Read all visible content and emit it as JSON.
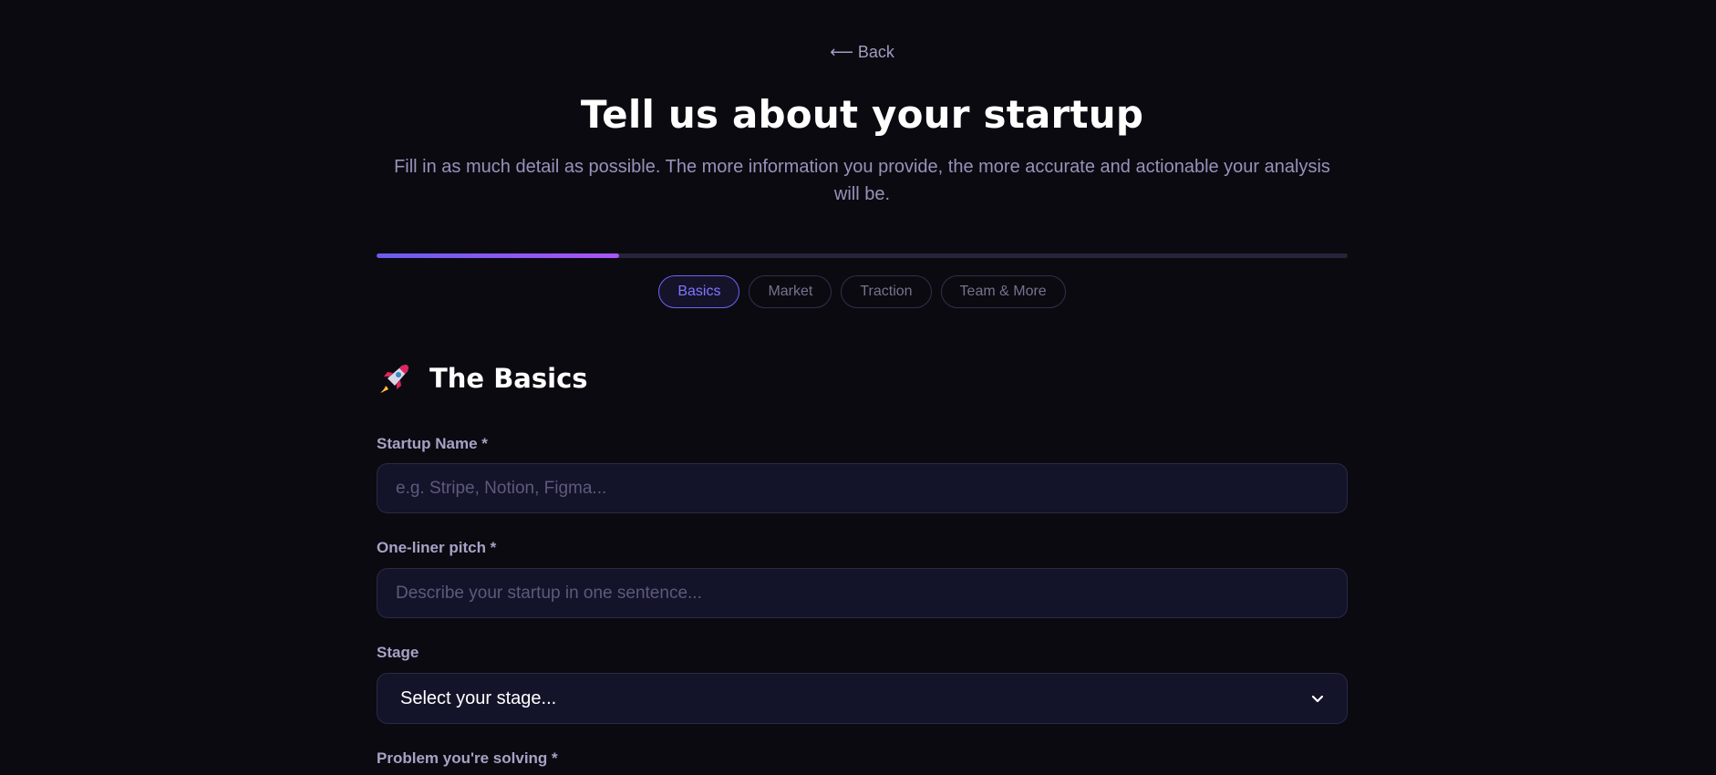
{
  "nav": {
    "back_arrow": "⟵",
    "back_label": "Back"
  },
  "header": {
    "title": "Tell us about your startup",
    "subtitle": "Fill in as much detail as possible. The more information you provide, the more accurate and actionable your analysis will be."
  },
  "progress": {
    "fraction": 0.25,
    "accent_start": "#6a5cf0",
    "accent_end": "#a855f7"
  },
  "steps": [
    {
      "label": "Basics",
      "active": true
    },
    {
      "label": "Market",
      "active": false
    },
    {
      "label": "Traction",
      "active": false
    },
    {
      "label": "Team & More",
      "active": false
    }
  ],
  "section": {
    "icon": "rocket-icon",
    "title": "The Basics"
  },
  "form": {
    "startup_name": {
      "label": "Startup Name *",
      "placeholder": "e.g. Stripe, Notion, Figma...",
      "value": ""
    },
    "pitch": {
      "label": "One-liner pitch *",
      "placeholder": "Describe your startup in one sentence...",
      "value": ""
    },
    "stage": {
      "label": "Stage",
      "selected": "Select your stage..."
    },
    "problem": {
      "label": "Problem you're solving *"
    }
  }
}
